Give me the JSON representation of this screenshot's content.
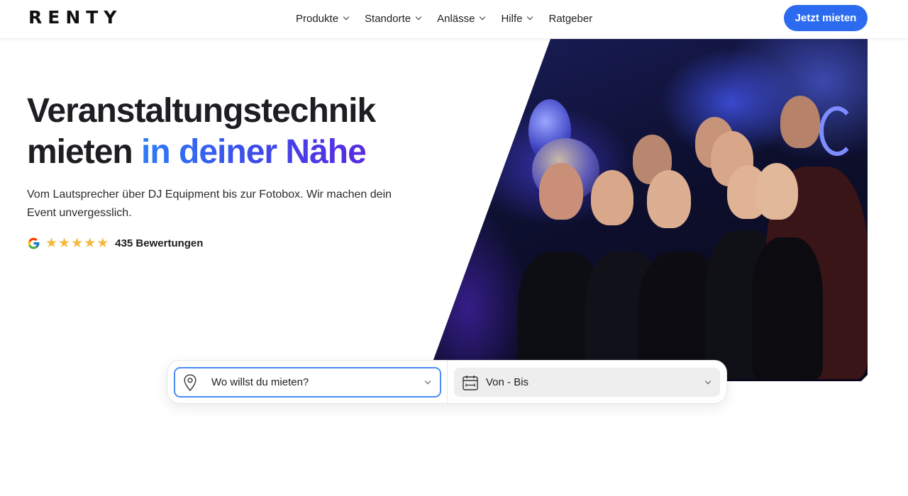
{
  "brand": {
    "logo_text": "RENTY"
  },
  "nav": {
    "items": [
      {
        "label": "Produkte",
        "has_dropdown": true
      },
      {
        "label": "Standorte",
        "has_dropdown": true
      },
      {
        "label": "Anlässe",
        "has_dropdown": true
      },
      {
        "label": "Hilfe",
        "has_dropdown": true
      },
      {
        "label": "Ratgeber",
        "has_dropdown": false
      }
    ],
    "cta_label": "Jetzt mieten"
  },
  "hero": {
    "title_line1": "Veranstaltungstechnik",
    "title_line2_plain": "mieten ",
    "title_line2_accent": "in deiner Nähe",
    "subtitle": "Vom Lautsprecher über DJ Equipment bis zur Fotobox. Wir machen dein Event unvergesslich.",
    "rating": {
      "stars": 5,
      "reviews_label": "435 Bewertungen"
    },
    "image_alt": "Gruppe junger Menschen feiert auf einer Party"
  },
  "search": {
    "location_placeholder": "Wo willst du mieten?",
    "date_label": "Von - Bis"
  },
  "colors": {
    "primary": "#2c6bf0",
    "accent_gradient_start": "#2e7cf6",
    "accent_gradient_end": "#5b2ae0",
    "star": "#f5b83c",
    "focus_border": "#4a8cf5"
  }
}
